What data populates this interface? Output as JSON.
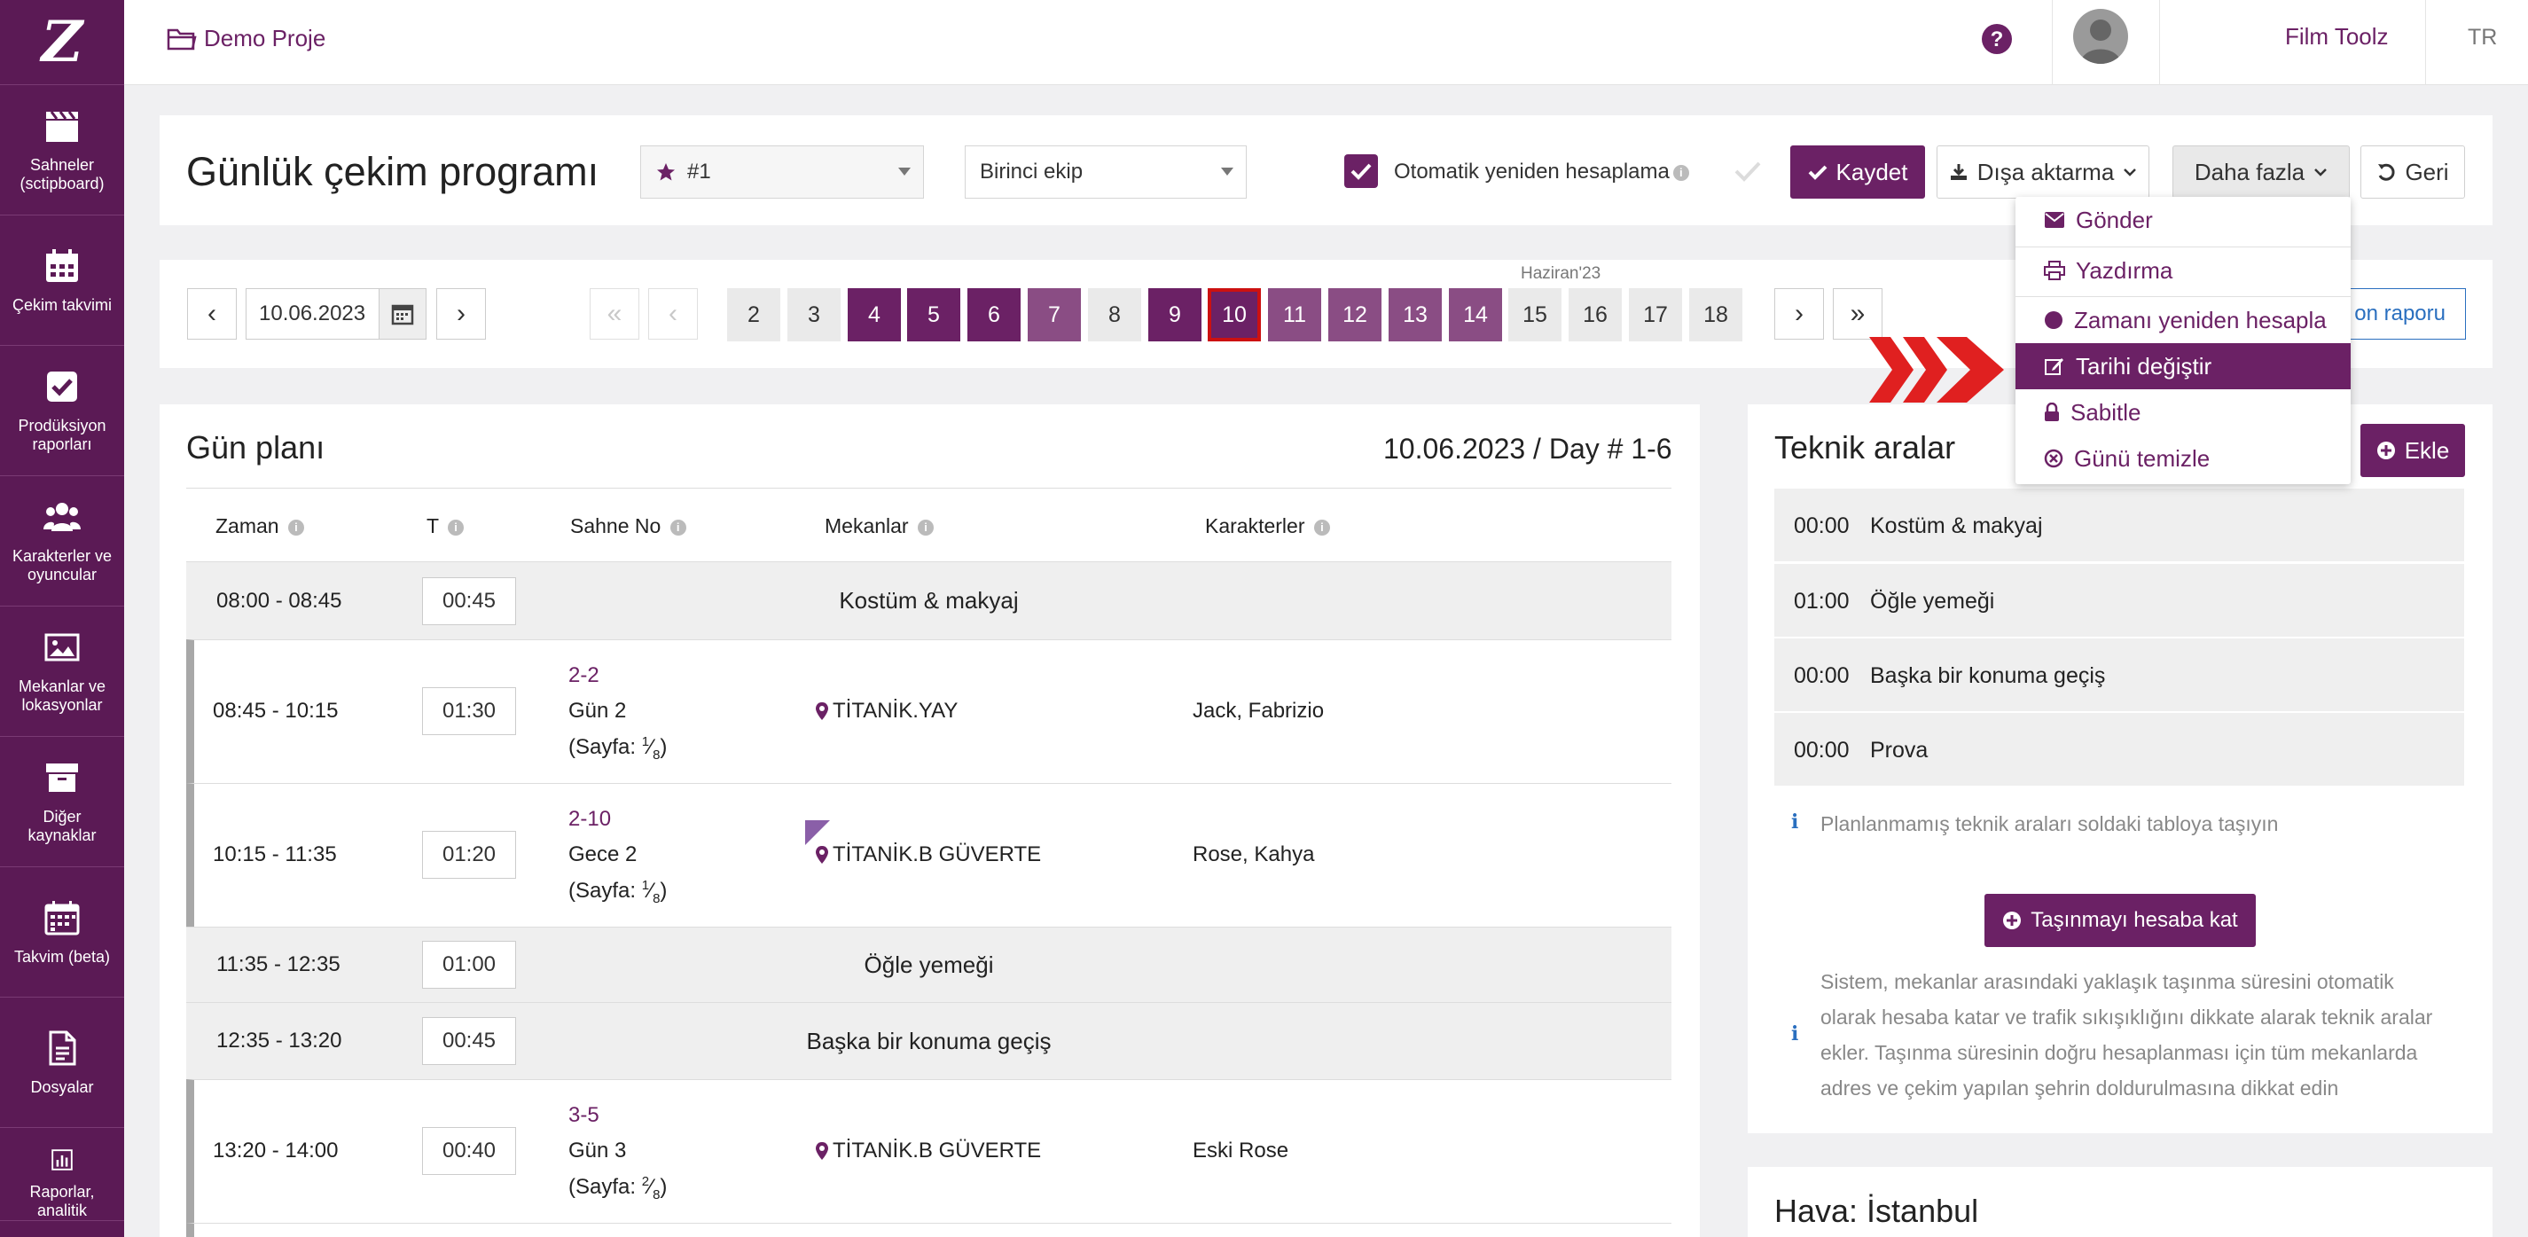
{
  "project": {
    "name": "Demo Proje"
  },
  "topbar": {
    "user": "Film Toolz",
    "lang": "TR"
  },
  "sidebar": {
    "items": [
      {
        "label": "Sahneler (sctipboard)",
        "icon": "clapperboard-icon"
      },
      {
        "label": "Çekim takvimi",
        "icon": "calendar-icon"
      },
      {
        "label": "Prodüksiyon raporları",
        "icon": "checkbox-icon"
      },
      {
        "label": "Karakterler ve oyuncular",
        "icon": "users-icon"
      },
      {
        "label": "Mekanlar ve lokasyonlar",
        "icon": "image-icon"
      },
      {
        "label": "Diğer kaynaklar",
        "icon": "archive-icon"
      },
      {
        "label": "Takvim (beta)",
        "icon": "calendar-grid-icon"
      },
      {
        "label": "Dosyalar",
        "icon": "file-icon"
      },
      {
        "label": "Raporlar, analitik",
        "icon": "bar-chart-icon"
      }
    ]
  },
  "header": {
    "title": "Günlük çekim programı",
    "schedule_select": "#1",
    "crew_select": "Birinci ekip",
    "auto_recalc_label": "Otomatik yeniden hesaplama",
    "save_label": "Kaydet",
    "export_label": "Dışa aktarma",
    "more_label": "Daha fazla",
    "back_label": "Geri"
  },
  "datebar": {
    "date": "10.06.2023",
    "month_label": "Haziran'23",
    "report_label": "on raporu",
    "days": [
      {
        "n": "2",
        "state": "plain"
      },
      {
        "n": "3",
        "state": "plain"
      },
      {
        "n": "4",
        "state": "dark"
      },
      {
        "n": "5",
        "state": "dark"
      },
      {
        "n": "6",
        "state": "dark"
      },
      {
        "n": "7",
        "state": "mid"
      },
      {
        "n": "8",
        "state": "plain"
      },
      {
        "n": "9",
        "state": "dark"
      },
      {
        "n": "10",
        "state": "selected"
      },
      {
        "n": "11",
        "state": "mid"
      },
      {
        "n": "12",
        "state": "mid"
      },
      {
        "n": "13",
        "state": "mid"
      },
      {
        "n": "14",
        "state": "mid"
      },
      {
        "n": "15",
        "state": "plain"
      },
      {
        "n": "16",
        "state": "plain"
      },
      {
        "n": "17",
        "state": "plain"
      },
      {
        "n": "18",
        "state": "plain"
      }
    ]
  },
  "dayplan": {
    "title": "Gün planı",
    "date_day": "10.06.2023 / Day # 1-6",
    "columns": {
      "time": "Zaman",
      "t": "T",
      "scene": "Sahne No",
      "locations": "Mekanlar",
      "characters": "Karakterler"
    },
    "rows": [
      {
        "time": "08:00 - 08:45",
        "dur": "00:45",
        "label": "Kostüm & makyaj"
      },
      {
        "time": "08:45 - 10:15",
        "dur": "01:30",
        "scene": "2-2",
        "sub": "Gün 2",
        "page_prefix": "(Sayfa:",
        "page_num": "1",
        "page_den": "8",
        "page_suffix": ")",
        "location": "TİTANİK.YAY",
        "characters": "Jack, Fabrizio"
      },
      {
        "time": "10:15 - 11:35",
        "dur": "01:20",
        "scene": "2-10",
        "sub": "Gece 2",
        "page_prefix": "(Sayfa:",
        "page_num": "1",
        "page_den": "8",
        "page_suffix": ")",
        "location": "TİTANİK.B GÜVERTE",
        "characters": "Rose, Kahya"
      },
      {
        "time": "11:35 - 12:35",
        "dur": "01:00",
        "label": "Öğle yemeği"
      },
      {
        "time": "12:35 - 13:20",
        "dur": "00:45",
        "label": "Başka bir konuma geçiş"
      },
      {
        "time": "13:20 - 14:00",
        "dur": "00:40",
        "scene": "3-5",
        "sub": "Gün 3",
        "page_prefix": "(Sayfa:",
        "page_num": "2",
        "page_den": "8",
        "page_suffix": ")",
        "location": "TİTANİK.B GÜVERTE",
        "characters": "Eski Rose"
      }
    ]
  },
  "tech": {
    "title": "Teknik aralar",
    "add_label": "Ekle",
    "items": [
      {
        "t": "00:00",
        "name": "Kostüm & makyaj"
      },
      {
        "t": "01:00",
        "name": "Öğle yemeği"
      },
      {
        "t": "00:00",
        "name": "Başka bir konuma geçiş"
      },
      {
        "t": "00:00",
        "name": "Prova"
      }
    ],
    "hint1": "Planlanmamış teknik araları soldaki tabloya taşıyın",
    "travel_btn": "Taşınmayı hesaba kat",
    "hint2_lines": [
      "Sistem, mekanlar arasındaki yaklaşık taşınma süresini otomatik",
      "olarak hesaba katar ve trafik sıkışıklığını dikkate alarak teknik aralar",
      "ekler. Taşınma süresinin doğru hesaplanması için tüm mekanlarda",
      "adres ve çekim yapılan şehrin doldurulmasına dikkat edin"
    ]
  },
  "weather": {
    "title": "Hava: İstanbul"
  },
  "menu": {
    "items": [
      {
        "label": "Gönder",
        "icon": "envelope-icon"
      },
      {
        "label": "Yazdırma",
        "icon": "printer-icon"
      },
      {
        "label": "Zamanı yeniden hesapla",
        "icon": "circle-icon"
      },
      {
        "label": "Tarihi değiştir",
        "icon": "edit-icon"
      },
      {
        "label": "Sabitle",
        "icon": "lock-icon"
      },
      {
        "label": "Günü temizle",
        "icon": "clear-icon"
      }
    ]
  }
}
